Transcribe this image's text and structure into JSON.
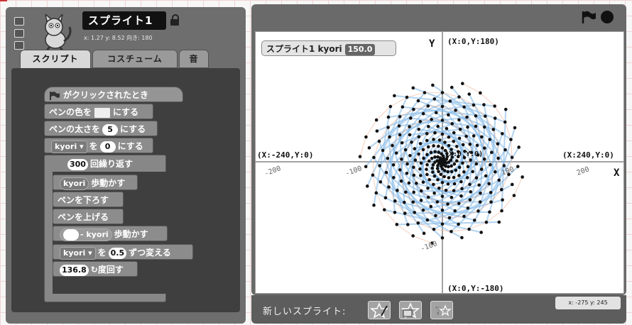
{
  "sprite": {
    "name": "スプライト1",
    "info": "x: 1.27 y: 8.52 向き: 180"
  },
  "tabs": [
    {
      "label": "スクリプト",
      "active": true
    },
    {
      "label": "コスチューム",
      "active": false
    },
    {
      "label": "音",
      "active": false
    }
  ],
  "script": {
    "when_flag": "がクリックされたとき",
    "set_pen_color": {
      "pre": "ペンの色を",
      "post": "にする"
    },
    "set_pen_size": {
      "pre": "ペンの太さを",
      "value": "5",
      "post": "にする"
    },
    "set_var": {
      "var": "kyori",
      "mid": "を",
      "value": "0",
      "post": "にする"
    },
    "repeat": {
      "value": "300",
      "post": "回繰り返す"
    },
    "move1": {
      "var": "kyori",
      "post": "歩動かす"
    },
    "pen_down": "ペンを下ろす",
    "pen_up": "ペンを上げる",
    "move2": {
      "op": "-",
      "var": "kyori",
      "post": "歩動かす"
    },
    "change_var": {
      "var": "kyori",
      "mid": "を",
      "value": "0.5",
      "post": "ずつ変える"
    },
    "turn": {
      "value": "136.8",
      "post": "度回す",
      "arrow": "↻"
    }
  },
  "stage": {
    "watcher": {
      "label": "スプライト1 kyori",
      "value": "150.0"
    },
    "axis_y_label": "Y",
    "axis_x_label": "X",
    "top_label": "(X:0,Y:180)",
    "bottom_label": "(X:0,Y:-180)",
    "left_label": "(X:-240,Y:0)",
    "right_label": "(X:240,Y:0)",
    "center_label": "(X:0,Y:0)",
    "ticks": {
      "x_neg200": "-200",
      "x_neg100": "-100",
      "x_100": "100",
      "x_200": "200",
      "y_neg100": "-100"
    },
    "pattern": {
      "count": 300,
      "turn_degrees": 136.8,
      "step_change": 0.5,
      "dot_color": "#111111",
      "trail_colors": [
        "#7fb6e6",
        "#f2b79a"
      ]
    }
  },
  "bottom": {
    "new_sprite": "新しいスプライト:",
    "coords": "x: -275 y: 245",
    "buttons": [
      {
        "icon": "paint-new-sprite-icon"
      },
      {
        "icon": "choose-sprite-file-icon"
      },
      {
        "icon": "random-sprite-icon"
      }
    ]
  }
}
